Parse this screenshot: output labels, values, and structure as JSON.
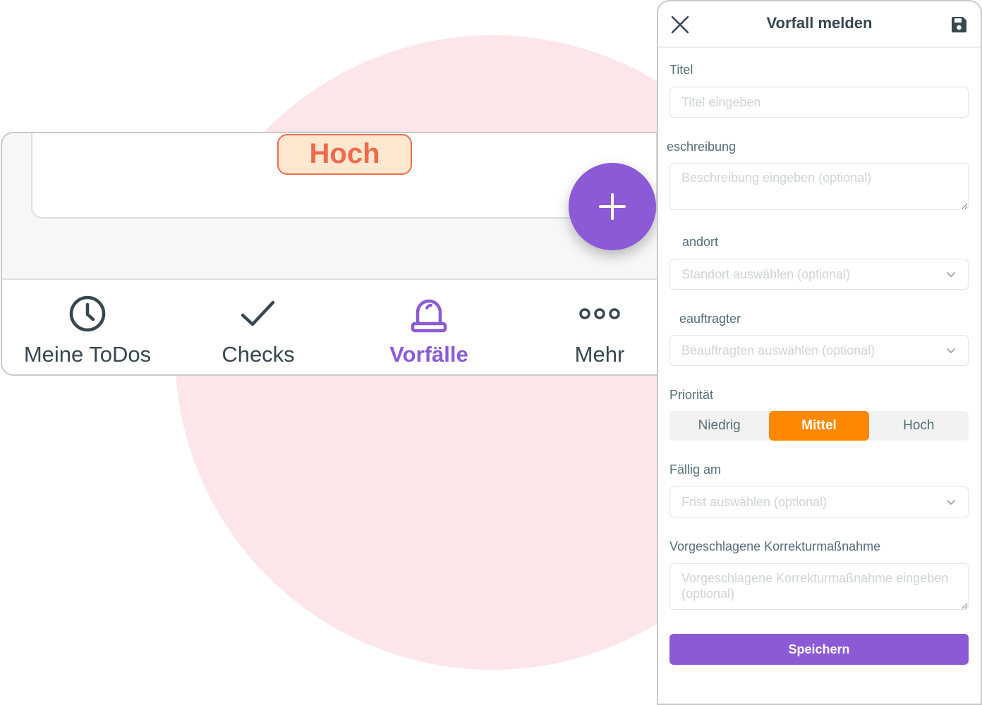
{
  "colors": {
    "accent": "#8c5ad6",
    "priority_high": "#ef6a4d",
    "priority_selected": "#ff8800",
    "background_blob": "#fde6ea"
  },
  "incident_card": {
    "priority_badge": "Hoch"
  },
  "fab": {
    "icon": "plus-icon"
  },
  "bottom_nav": {
    "items": [
      {
        "label": "Meine ToDos",
        "icon": "clock-icon",
        "active": false
      },
      {
        "label": "Checks",
        "icon": "checkmark-icon",
        "active": false
      },
      {
        "label": "Vorfälle",
        "icon": "alarm-light-icon",
        "active": true
      },
      {
        "label": "Mehr",
        "icon": "more-dots-icon",
        "active": false
      }
    ]
  },
  "form": {
    "title": "Vorfall melden",
    "close_icon": "close-icon",
    "save_icon": "save-icon",
    "fields": {
      "titel": {
        "label": "Titel",
        "placeholder": "Titel eingeben"
      },
      "beschreibung": {
        "label": "eschreibung",
        "placeholder": "Beschreibung eingeben (optional)"
      },
      "standort": {
        "label": "andort",
        "placeholder": "Standort auswählen (optional)"
      },
      "beauftragter": {
        "label": "eauftragter",
        "placeholder": "Beauftragten auswählen (optional)"
      },
      "prioritaet": {
        "label": "Priorität",
        "options": [
          "Niedrig",
          "Mittel",
          "Hoch"
        ],
        "selected": "Mittel"
      },
      "faellig": {
        "label": "Fällig am",
        "placeholder": "Frist auswählen (optional)"
      },
      "korrektur": {
        "label": "Vorgeschlagene Korrekturmaßnahme",
        "placeholder": "Vorgeschlagene Korrekturmaßnahme eingeben (optional)"
      }
    },
    "submit_label": "Speichern"
  }
}
